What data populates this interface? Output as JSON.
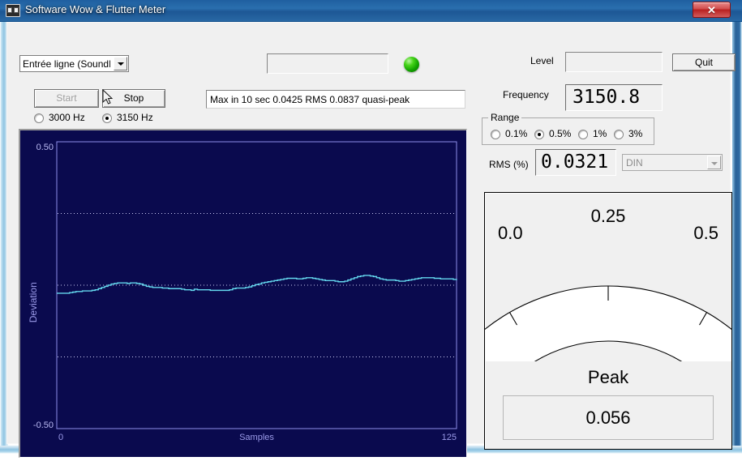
{
  "window": {
    "title": "Software Wow & Flutter Meter",
    "icon": "cassette-icon",
    "close_label": "✕"
  },
  "toolbar": {
    "source_select_value": "Entrée ligne (SoundMAX",
    "start_label": "Start",
    "stop_label": "Stop",
    "freq_radios": [
      {
        "label": "3000 Hz",
        "selected": false
      },
      {
        "label": "3150 Hz",
        "selected": true
      }
    ],
    "top_input_value": "",
    "led_state": "green",
    "status_text": "Max in 10 sec 0.0425 RMS 0.0837 quasi-peak"
  },
  "right_panel": {
    "level_label": "Level",
    "level_value": "",
    "frequency_label": "Frequency",
    "frequency_value": "3150.8",
    "quit_label": "Quit",
    "range_legend": "Range",
    "range_options": [
      {
        "label": "0.1%",
        "selected": false
      },
      {
        "label": "0.5%",
        "selected": true
      },
      {
        "label": "1%",
        "selected": false
      },
      {
        "label": "3%",
        "selected": false
      }
    ],
    "rms_label": "RMS (%)",
    "rms_value": "0.0321",
    "weighting_value": "DIN"
  },
  "meter": {
    "scale_left": "0.0",
    "scale_mid": "0.25",
    "scale_right": "0.5",
    "peak_label": "Peak",
    "peak_value": "0.056",
    "needle_value": 0.056,
    "needle_color": "#bb0d12",
    "scale_min": 0.0,
    "scale_max": 0.5
  },
  "chart_data": {
    "type": "line",
    "title": "",
    "xlabel": "Samples",
    "ylabel": "Deviation",
    "xlim": [
      0,
      125
    ],
    "ylim": [
      -0.5,
      0.5
    ],
    "xticks": [
      "0",
      "125"
    ],
    "yticks": [
      "0.50",
      "-0.50"
    ],
    "gridlines_y": [
      0.25,
      0.0,
      -0.25
    ],
    "grid": true,
    "background": "#0a0a4e",
    "line_color": "#64d8ee",
    "series": [
      {
        "name": "Deviation",
        "x": [
          0,
          1,
          2,
          3,
          4,
          5,
          6,
          7,
          8,
          9,
          10,
          11,
          12,
          13,
          14,
          15,
          16,
          17,
          18,
          19,
          20,
          21,
          22,
          23,
          24,
          25,
          26,
          27,
          28,
          29,
          30,
          31,
          32,
          33,
          34,
          35,
          36,
          37,
          38,
          39,
          40,
          41,
          42,
          43,
          44,
          45,
          46,
          47,
          48,
          49,
          50,
          51,
          52,
          53,
          54,
          55,
          56,
          57,
          58,
          59,
          60,
          61,
          62,
          63,
          64,
          65,
          66,
          67,
          68,
          69,
          70,
          71,
          72,
          73,
          74,
          75,
          76,
          77,
          78,
          79,
          80,
          81,
          82,
          83,
          84,
          85,
          86,
          87,
          88,
          89,
          90,
          91,
          92,
          93,
          94,
          95,
          96,
          97,
          98,
          99,
          100,
          101,
          102,
          103,
          104,
          105,
          106,
          107,
          108,
          109,
          110,
          111,
          112,
          113,
          114,
          115,
          116,
          117,
          118,
          119,
          120,
          121,
          122,
          123,
          124,
          125
        ],
        "y": [
          -0.028,
          -0.028,
          -0.028,
          -0.028,
          -0.026,
          -0.024,
          -0.022,
          -0.022,
          -0.02,
          -0.02,
          -0.02,
          -0.018,
          -0.016,
          -0.012,
          -0.008,
          -0.004,
          0.0,
          0.004,
          0.006,
          0.008,
          0.008,
          0.008,
          0.006,
          0.008,
          0.008,
          0.006,
          0.004,
          0.0,
          -0.004,
          -0.006,
          -0.008,
          -0.008,
          -0.008,
          -0.01,
          -0.01,
          -0.012,
          -0.012,
          -0.012,
          -0.012,
          -0.014,
          -0.016,
          -0.016,
          -0.018,
          -0.014,
          -0.016,
          -0.016,
          -0.016,
          -0.016,
          -0.018,
          -0.018,
          -0.018,
          -0.018,
          -0.018,
          -0.018,
          -0.016,
          -0.012,
          -0.01,
          -0.01,
          -0.01,
          -0.008,
          -0.006,
          -0.002,
          0.002,
          0.004,
          0.008,
          0.01,
          0.012,
          0.014,
          0.016,
          0.018,
          0.02,
          0.022,
          0.024,
          0.024,
          0.024,
          0.022,
          0.022,
          0.024,
          0.026,
          0.026,
          0.024,
          0.022,
          0.02,
          0.018,
          0.016,
          0.016,
          0.016,
          0.014,
          0.012,
          0.012,
          0.014,
          0.018,
          0.022,
          0.026,
          0.03,
          0.032,
          0.034,
          0.034,
          0.032,
          0.03,
          0.026,
          0.022,
          0.02,
          0.018,
          0.018,
          0.018,
          0.016,
          0.014,
          0.014,
          0.016,
          0.018,
          0.02,
          0.022,
          0.024,
          0.026,
          0.026,
          0.026,
          0.026,
          0.024,
          0.024,
          0.022,
          0.022,
          0.022,
          0.022,
          0.02,
          0.018
        ]
      }
    ]
  }
}
